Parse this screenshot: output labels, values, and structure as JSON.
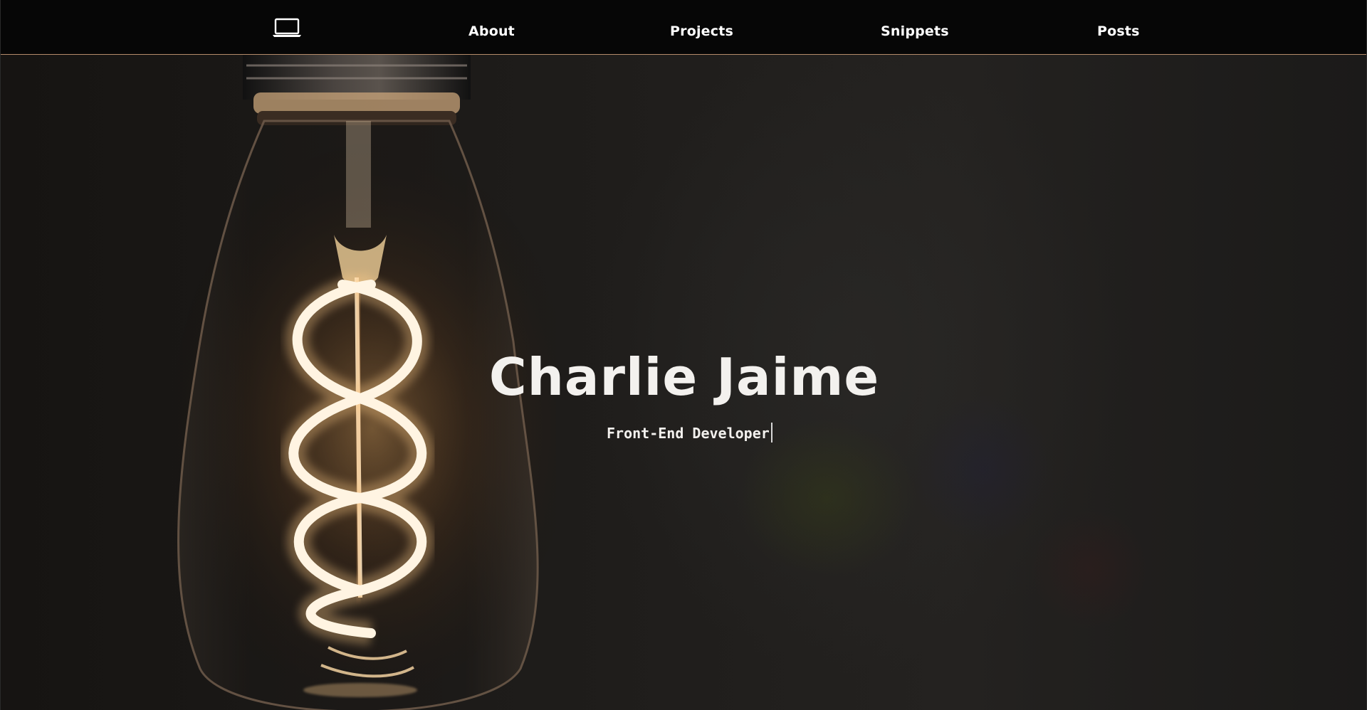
{
  "nav": {
    "logo_icon": "laptop-icon",
    "links": [
      {
        "label": "About"
      },
      {
        "label": "Projects"
      },
      {
        "label": "Snippets"
      },
      {
        "label": "Posts"
      }
    ]
  },
  "hero": {
    "name": "Charlie Jaime",
    "role": "Front-End Developer"
  },
  "colors": {
    "nav_background": "#060606",
    "nav_border": "#b48b6a",
    "text": "#f3f1ee",
    "filament_glow": "#ffd9a0"
  }
}
